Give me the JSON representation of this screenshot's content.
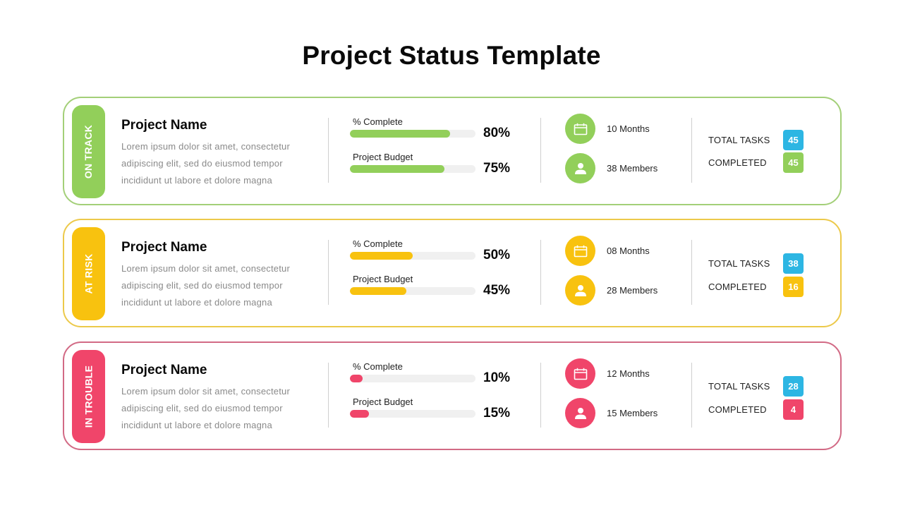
{
  "title": "Project Status Template",
  "colors": {
    "on_track": "#92cf5a",
    "on_track_border": "#a3cf78",
    "at_risk": "#f8c20f",
    "at_risk_border": "#ecc94a",
    "in_trouble": "#f0456a",
    "in_trouble_border": "#d26a85",
    "total_tasks": "#2db6e3",
    "track": "#f0f0f0"
  },
  "projects": [
    {
      "status": "ON TRACK",
      "status_key": "on_track",
      "name": "Project Name",
      "description": "Lorem ipsum dolor sit amet, consectetur adipiscing elit, sed do eiusmod tempor incididunt ut labore et dolore magna",
      "metrics": [
        {
          "label": "% Complete",
          "value": 80,
          "value_text": "80%"
        },
        {
          "label": "Project Budget",
          "value": 75,
          "value_text": "75%"
        }
      ],
      "duration": {
        "icon": "calendar-icon",
        "text": "10 Months"
      },
      "members": {
        "icon": "user-icon",
        "text": "38 Members"
      },
      "total_tasks": {
        "label": "TOTAL TASKS",
        "value": "45"
      },
      "completed": {
        "label": "COMPLETED",
        "value": "45"
      }
    },
    {
      "status": "AT RISK",
      "status_key": "at_risk",
      "name": "Project Name",
      "description": "Lorem ipsum dolor sit amet, consectetur adipiscing elit, sed do eiusmod tempor incididunt ut labore et dolore magna",
      "metrics": [
        {
          "label": "% Complete",
          "value": 50,
          "value_text": "50%"
        },
        {
          "label": "Project Budget",
          "value": 45,
          "value_text": "45%"
        }
      ],
      "duration": {
        "icon": "calendar-icon",
        "text": "08 Months"
      },
      "members": {
        "icon": "user-icon",
        "text": "28 Members"
      },
      "total_tasks": {
        "label": "TOTAL TASKS",
        "value": "38"
      },
      "completed": {
        "label": "COMPLETED",
        "value": "16"
      }
    },
    {
      "status": "IN TROUBLE",
      "status_key": "in_trouble",
      "name": "Project Name",
      "description": "Lorem ipsum dolor sit amet, consectetur adipiscing elit, sed do eiusmod tempor incididunt ut labore et dolore magna",
      "metrics": [
        {
          "label": "% Complete",
          "value": 10,
          "value_text": "10%"
        },
        {
          "label": "Project Budget",
          "value": 15,
          "value_text": "15%"
        }
      ],
      "duration": {
        "icon": "calendar-icon",
        "text": "12 Months"
      },
      "members": {
        "icon": "user-icon",
        "text": "15 Members"
      },
      "total_tasks": {
        "label": "TOTAL TASKS",
        "value": "28"
      },
      "completed": {
        "label": "COMPLETED",
        "value": "4"
      }
    }
  ]
}
